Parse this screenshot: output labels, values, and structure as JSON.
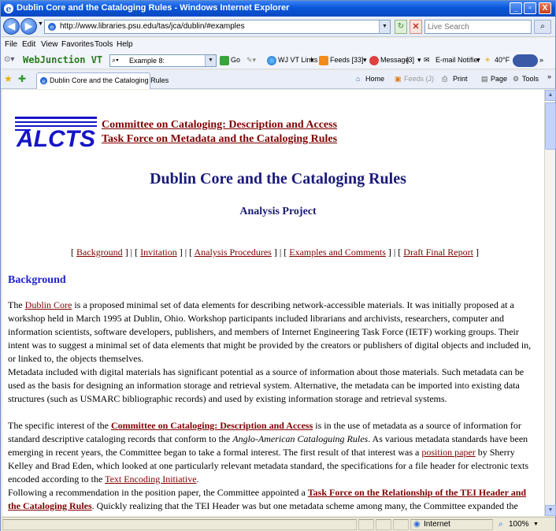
{
  "window": {
    "title": "Dublin Core and the Cataloging Rules - Windows Internet Explorer",
    "controls": {
      "minimize": "_",
      "maximize": "▫",
      "close": "X"
    }
  },
  "address": {
    "url": "http://www.libraries.psu.edu/tas/jca/dublin/#examples",
    "search_placeholder": "Live Search"
  },
  "menu": [
    "File",
    "Edit",
    "View",
    "Favorites",
    "Tools",
    "Help"
  ],
  "toolbar": {
    "brand": "WebJunction VT",
    "example_field": "Example 8:",
    "go": "Go",
    "wj_links": "WJ VT Links",
    "feeds": "Feeds [33]",
    "message": "Message",
    "message_count": "[3]",
    "email_notifier": "E-mail Notifier",
    "weather": "40°F"
  },
  "tabs": {
    "active_tab": "Dublin Core and the Cataloging Rules",
    "home": "Home",
    "feeds": "Feeds (J)",
    "print": "Print",
    "page": "Page",
    "tools": "Tools"
  },
  "page": {
    "logo_text": "ALCTS",
    "header_link_1": "Committee on Cataloging: Description and Access",
    "header_link_2": "Task Force on Metadata and the Cataloging Rules",
    "title": "Dublin Core and the Cataloging Rules",
    "subtitle": "Analysis Project",
    "nav": [
      "Background",
      "Invitation",
      "Analysis Procedures",
      "Examples and Comments",
      "Draft Final Report"
    ],
    "section_heading": "Background",
    "p1": {
      "before": "The ",
      "link": "Dublin Core",
      "after": " is a proposed minimal set of data elements for describing network-accessible materials. It was initially proposed at a workshop held in March 1995 at Dublin, Ohio. Workshop participants included librarians and archivists, researchers, computer and information scientists, software developers, publishers, and members of Internet Engineering Task Force (IETF) working groups. Their intent was to suggest a minimal set of data elements that might be provided by the creators or publishers of digital objects and included in, or linked to, the objects themselves."
    },
    "p2": "Metadata included with digital materials has significant potential as a source of information about those materials. Such metadata can be used as the basis for designing an information storage and retrieval system. Alternative, the metadata can be imported into existing data structures (such as USMARC bibliographic records) and used by existing information storage and retrieval systems.",
    "p3": {
      "t1": "The specific interest of the ",
      "link1": "Committee on Cataloging: Description and Access",
      "t2": " is in the use of metadata as a source of information for standard descriptive cataloging records that conform to the ",
      "italic": "Anglo-American Cataloguing Rules",
      "t3": ". As various metadata standards have been emerging in recent years, the Committee began to take a formal interest. The first result of that interest was a ",
      "link2": "position paper",
      "t4": " by Sherry Kelley and Brad Eden, which looked at one particularly relevant metadata standard, the specifications for a file header for electronic texts encoded according to the ",
      "link3": "Text Encoding Initiative",
      "t5": "."
    },
    "p4": {
      "t1": "Following a recommendation in the position paper, the Committee appointed a ",
      "link": "Task Force on the Relationship of the TEI Header and the Cataloging Rules",
      "t2": ". Quickly realizing that the TEI Header was but one metadata scheme among many, the Committee expanded the Task Force's charge to include other"
    }
  },
  "status": {
    "zone": "Internet",
    "zoom": "100%"
  },
  "colors": {
    "link": "#800000",
    "title": "#1a1a7a",
    "section_heading": "#2020d0",
    "logo_blue": "#1515c8"
  }
}
